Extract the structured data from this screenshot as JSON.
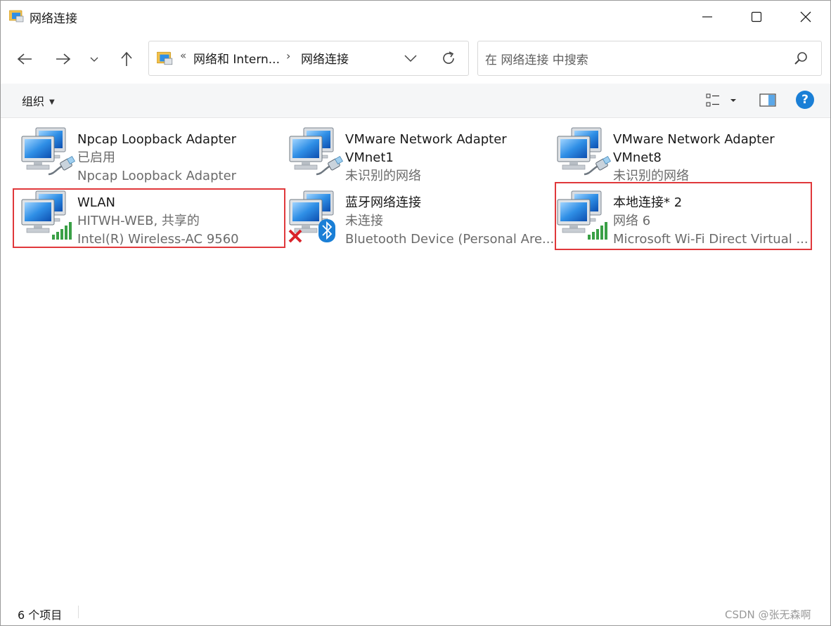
{
  "window": {
    "title": "网络连接"
  },
  "nav": {
    "address_overflow": "«",
    "address_segments": [
      "网络和 Intern...",
      "网络连接"
    ],
    "address_separator": "›",
    "search_placeholder": "在 网络连接 中搜索"
  },
  "toolbar": {
    "organize_label": "组织",
    "help_label": "?"
  },
  "items": [
    {
      "name": "Npcap Loopback Adapter",
      "line2": "已启用",
      "line3": "Npcap Loopback Adapter",
      "badge": "cable-icon",
      "highlighted": false
    },
    {
      "name": "VMware Network Adapter",
      "name2": "VMnet1",
      "line2": "未识别的网络",
      "badge": "cable-icon",
      "highlighted": false
    },
    {
      "name": "VMware Network Adapter",
      "name2": "VMnet8",
      "line2": "未识别的网络",
      "badge": "cable-icon",
      "highlighted": false
    },
    {
      "name": "WLAN",
      "line2": "HITWH-WEB, 共享的",
      "line3": "Intel(R) Wireless-AC 9560",
      "badge": "signal-bars-icon",
      "highlighted": true
    },
    {
      "name": "蓝牙网络连接",
      "line2": "未连接",
      "line3": "Bluetooth Device (Personal Are...",
      "badge": "bluetooth-icon",
      "highlighted": false
    },
    {
      "name": "本地连接* 2",
      "line2": "网络 6",
      "line3": "Microsoft Wi-Fi Direct Virtual ...",
      "badge": "signal-bars-icon",
      "highlighted": true
    }
  ],
  "status": {
    "count_text": "6 个项目",
    "watermark": "CSDN @张无森啊"
  },
  "colors": {
    "highlight_border": "#e0383b",
    "help_blue": "#1a7fd6",
    "signal_green": "#3aa046",
    "disconnect_red": "#d9232a"
  }
}
